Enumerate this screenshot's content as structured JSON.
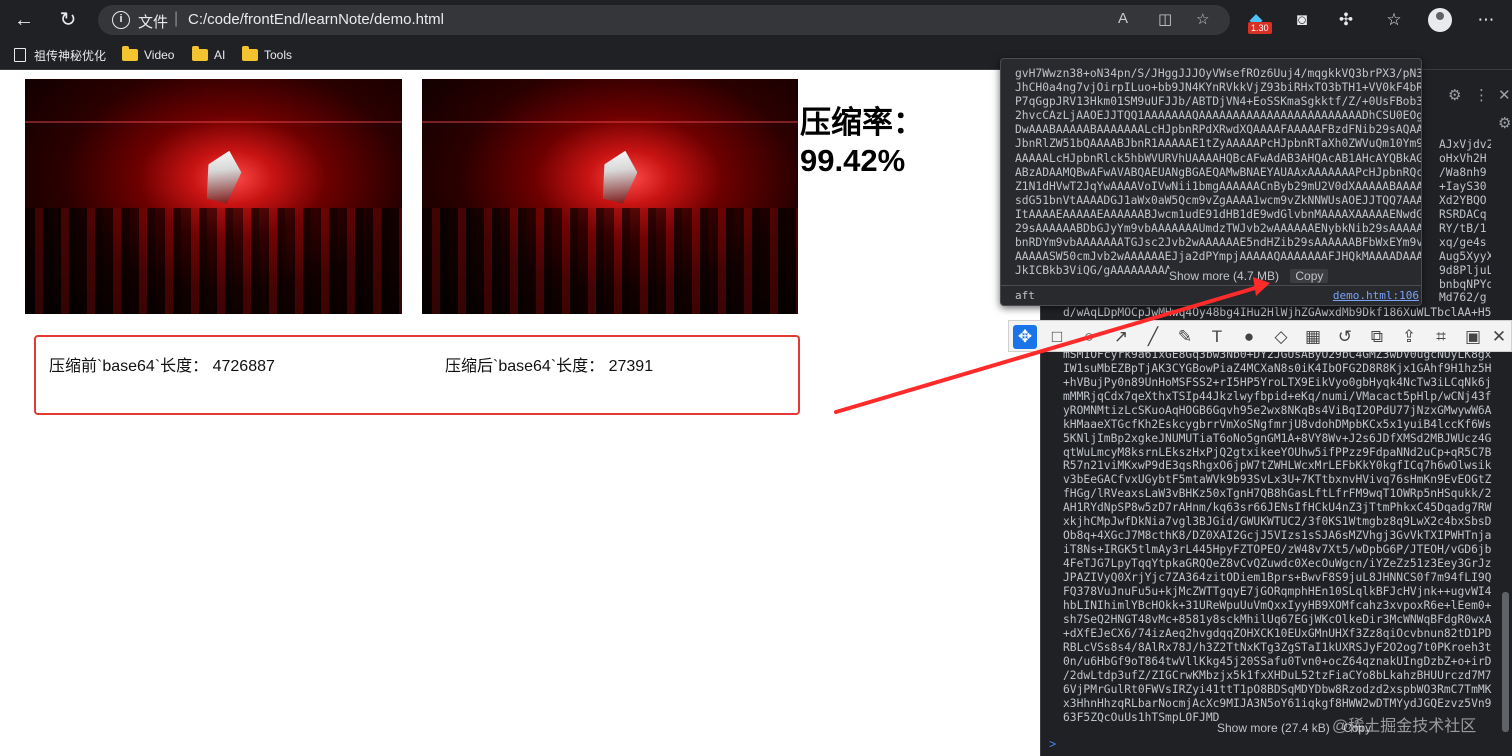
{
  "browser": {
    "protocol_label": "文件",
    "url": "C:/code/frontEnd/learnNote/demo.html",
    "ext_badge": "1.30",
    "bookmarks": [
      {
        "label": "祖传神秘优化",
        "type": "page"
      },
      {
        "label": "Video",
        "type": "folder"
      },
      {
        "label": "AI",
        "type": "folder"
      },
      {
        "label": "Tools",
        "type": "folder"
      }
    ]
  },
  "page": {
    "ratio_label": "压缩率：",
    "ratio_value": "99.42%",
    "before_label": "压缩前`base64`长度：",
    "before_value": "4726887",
    "after_label": "压缩后`base64`长度：",
    "after_value": "27391"
  },
  "popup": {
    "code_lines": [
      "gvH7Wwzn38+oN34pn/S/JHggJJJOyVWsefROz6Uuj4/mqgkkVQ3brPX3/pN3Bme",
      "JhCH0a4ng7vjOirpILuo+bb9JN4KYnRVkkVjZ93biRHxTO3bTH1+VV0kF4bRn0",
      "P7qGgpJRV13Hkm01SM9uUFJJb/ABTDjVN4+EoSSKmaSgkktf/Z/+0UsFBob3Rvd",
      "2hvcCAzLjAAOEJJTQQ1AAAAAAAQAAAAAAAAAAAAAAAAAAAAAAAADhCSU0EOgAAAAE2",
      "DwAAABAAAAABAAAAAAALcHJpbnRPdXRwdXQAAAAFAAAAAFBzdFNib29sAQAAAA",
      "JbnRlZW51bQAAAABJbnR1AAAAAE1tZyAAAAAPcHJpbnRTaXh0ZWVuQm10Ym9vbA",
      "AAAAALcHJpbnRlck5hbWVURVhUAAAAHQBcAFwAdAB3AHQAcAB1AHcAYQBkAG0Ac",
      "ABzADAAMQBwAFwAVABQAEUANgBGAEQAMwBNAEYAUAAxAAAAAAAPcHJpbnRQcm9v",
      "Z1N1dHVwT2JqYwAAAAVoIVwNii1bmgAAAAAACnByb29mU2V0dXAAAAABAAAAAE",
      "sdG51bnVtAAAADGJ1aWx0aW5Qcm9vZgAAAA1wcm9vZkNNWUsAOEJJTQQ7AAAAA",
      "ItAAAAEAAAAAEAAAAAABJwcm1udE91dHB1dE9wdGlvbnMAAAAXAAAAAENwdG5ib",
      "29sAAAAAABDbGJyYm9vbAAAAAAAUmdzTWJvb2wAAAAAAENybkNib29sAAAAABD",
      "bnRDYm9vbAAAAAAATGJsc2Jvb2wAAAAAAE5ndHZib29sAAAAAABFbWxEYm9vbA",
      "AAAAASW50cmJvb2wAAAAAAEJja2dPYmpjAAAAAQAAAAAAAFJHQkMAAAADAAAAA",
      "JkICBkb3ViQG/gAAAAAAAAA"
    ],
    "show_more": "Show more (4.7 MB)",
    "copy": "Copy",
    "next_line": "aft",
    "source_link": "demo.html:106"
  },
  "devtools": {
    "side_fragments": [
      "AJxVjdv2",
      "oHxVh2H",
      "/Wa8nh9",
      "+IayS30",
      "Xd2YBQO",
      "RSRDACq",
      "RY/tB/1",
      "xq/ge4s",
      "Aug5XyyX",
      "9d8PljuL",
      "bnbqNPYd",
      "Md762/g"
    ],
    "code_lines": [
      "d/wAqLDpMOCpJwMHwq4Oy48bg4IHu2HlWjhZGAwxdMb9Dkf186XuWLTbclAA+H5",
      "",
      "",
      "mSM1OFcyrk9a61xGE8Gq3bw3Nb0+DY2JGUsAByO29bC4GMZ3wDV0ugcNUyLK8gx",
      "IW1suMbEZBpTjAK3CYGBowPiaZ4MCXaN8s0iK4IbOFG2D8R8Kjx1GAhf9H1hz5H",
      "+hVBujPy0n89UnHoMSFSS2+rI5HP5YroLTX9EikVyo0gbHyqk4NcTw3iLCqNk6j",
      "mMMRjqCdx7qeXthxTSIp44Jkzlwyfbpid+eKq/numi/VMacact5pHlp/wCNj43f",
      "yROMNMtizLcSKuoAqHOGB6Gqvh95e2wx8NKqBs4ViBqI2OPdU77jNzxGMwywW6A",
      "kHMaaeXTGcfKh2EskcygbrrVmXoSNgfmrjU8vdohDMpbKCx5x1yuiB4lccKf6Ws",
      "5KNljImBp2xgkeJNUMUTiaT6oNo5gnGM1A+8VY8Wv+J2s6JDfXMSd2MBJWUcz4G",
      "qtWuLmcyM8ksrnLEkszHxPjQ2gtxikeeYOUhw5ifPPzz9FdpaNNd2uCp+qR5C7B",
      "R57n21viMKxwP9dE3qsRhgxO6jpW7tZWHLWcxMrLEFbKkY0kgfICq7h6wOlwsik",
      "v3bEeGACfvxUGybtF5mtaWVk9b93SvLx3U+7KTtbxnvHVivq76sHmKn9EvEOGtZ",
      "fHGg/lRVeaxsLaW3vBHKz50xTgnH7QB8hGasLftLfrFM9wqT1OWRp5nHSqukk/2",
      "AH1RYdNpSP8w5zD7rAHnm/kq63sr66JENsIfHCkU4nZ3jTtmPhkxC45Dqadg7RW",
      "xkjhCMpJwfDkNia7vgl3BJGid/GWUKWTUC2/3f0KS1Wtmgbz8q9LwX2c4bxSbsD",
      "Ob8q+4XGcJ7M8cthK8/DZ0XAI2GcjJ5VIzs1sSJA6sMZVhgj3GvVkTXIPWHTnja",
      "iT8Ns+IRGK5tlmAy3rL445HpyFZTOPEO/zW48v7Xt5/wDpbG6P/JTEOH/vGD6jb",
      "4FeTJG7LpyTqqYtpkaGRQQeZ8vCvQZuwdc0XecOuWgcn/iYZeZz51z3Eey3GrJz",
      "JPAZIVyQ0XrjYjc7ZA364zitODiem1Bprs+BwvF8S9juL8JHNNCS0f7m94fLI9Q",
      "FQ378VuJnuFu5u+kjMcZWTTgqyE7jGORqmphHEn10SLqlkBFJcHVjnk++ugvWI4",
      "hbLINIhimlYBcHOkk+31UReWpuUuVmQxxIyyHB9XOMfcahz3xvpoxR6e+lEem0+",
      "sh7SeQ2HNGT48vMc+8581y8sckMhilUq67EGjWKcOlkeDir3McWNWqBFdgR0wxA",
      "+dXfEJeCX6/74izAeq2hvgdqqZOHXCK10EUxGMnUHXf3Zz8qiOcvbnun82tD1PD",
      "RBLcVSs8s4/8AlRx78J/h3Z2TtNxKTg3ZgSTaI1kUXRSJyF2O2og7t0PKroeh3t",
      "0n/u6HbGf9oT864twVllKkg45j20SSafu0Tvn0+ocZ64qznakUIngDzbZ+o+irD",
      "/2dwLtdp3ufZ/ZIGCrwKMbzjx5k1fxXHDuL52tzFiaCYo8bLkahzBHUUrczd7M7",
      "6VjPMrGulRt0FWVsIRZyi41ttT1pO8BDSqMDYDbw8Rzodzd2xspbWO3RmC7TmMK",
      "x3HhnHhzqRLbarNocmjAcXc9MIJA3N5oY61iqkgf8HWW2wDTMYydJGQEzvz5Vn9",
      "63F5ZQcOuUs1hTSmpLOFJMD"
    ],
    "show_more": "Show more (27.4 kB)",
    "copy": "Copy",
    "prompt": ">"
  },
  "watermark": "@稀土掘金技术社区",
  "colors": {
    "result_border": "#e53935",
    "annotation_arrow": "#ff2a2a",
    "snip_active": "#1a73e8"
  }
}
